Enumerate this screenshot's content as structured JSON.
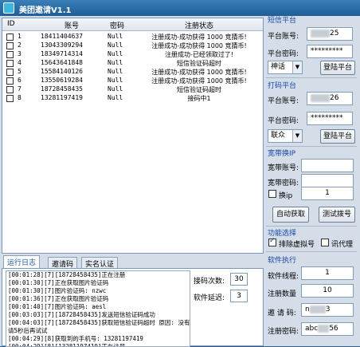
{
  "window": {
    "title": "美团邀请V1.1"
  },
  "table": {
    "headers": {
      "id": "ID",
      "account": "账号",
      "password": "密码",
      "status": "注册状态"
    },
    "rows": [
      {
        "id": "1",
        "account": "18411404637",
        "password": "Null",
        "status": "注册成功-成功获得 1000 竞猜币!"
      },
      {
        "id": "2",
        "account": "13043309294",
        "password": "Null",
        "status": "注册成功-成功获得 1000 竞猜币!"
      },
      {
        "id": "3",
        "account": "18349714314",
        "password": "Null",
        "status": "注册成功-已经领取过了!"
      },
      {
        "id": "4",
        "account": "15643641848",
        "password": "Null",
        "status": "短信验证码超时"
      },
      {
        "id": "5",
        "account": "15584140126",
        "password": "Null",
        "status": "注册成功-成功获得 1000 竞猜币!"
      },
      {
        "id": "6",
        "account": "13550619284",
        "password": "Null",
        "status": "注册成功-成功获得 1000 竞猜币!"
      },
      {
        "id": "7",
        "account": "18728458435",
        "password": "Null",
        "status": "短信验证码超时"
      },
      {
        "id": "8",
        "account": "13281197419",
        "password": "Null",
        "status": "接码中1"
      }
    ]
  },
  "tabs": [
    "运行日志",
    "邀请码",
    "实名认证"
  ],
  "log": {
    "lines": [
      "[00:01:28][7][18728458435]正在注册",
      "[00:01:30][7]正在获取图片验证码",
      "[00:01:30][7]图片验证码: nzwc",
      "[00:01:36][7]正在获取图片验证码",
      "[00:01:40][7]图片验证码: aesl",
      "[00:03:03][7][18728458435]发送短信验证码成功",
      "[00:04:03][7][18728458435]获取短信验证码超时    原因: 没有状态或",
      "  请5秒后再试试",
      "[00:04:29][8]获取到的手机号: 13281197419",
      "[00:04:29][8][13281197419]正在注册",
      "[00:04:30][8]正在获取图片验证码"
    ],
    "retry_label": "接码次数:",
    "retry_value": "30",
    "delay_label": "软件延迟:",
    "delay_value": "3"
  },
  "sms_platform": {
    "title": "短信平台",
    "account_label": "平台账号:",
    "account_suffix": "25",
    "password_label": "平台密码:",
    "password_value": "*********",
    "platform_select": "神话",
    "login_button": "登陆平台"
  },
  "dial_platform": {
    "title": "打码平台",
    "account_label": "平台账号:",
    "account_suffix": "26",
    "password_label": "平台密码:",
    "password_value": "*********",
    "platform_select": "联众",
    "login_button": "登陆平台"
  },
  "broadband": {
    "title": "宽带换IP",
    "account_label": "宽带账号:",
    "password_label": "宽带密码:",
    "switch_ip_label": "换ip",
    "switch_ip_value": "1",
    "auto_get_button": "自动获取",
    "test_dial_button": "测试拨号"
  },
  "features": {
    "title": "功能选择",
    "exclude_virtual_label": "排除虚拟号",
    "proxy_label": "讯代理"
  },
  "software": {
    "title": "软件执行",
    "threads_label": "软件线程:",
    "threads_value": "1",
    "register_count_label": "注册数量",
    "register_count_value": "10",
    "invite_label": "邀 请 码:",
    "invite_value_start": "n",
    "invite_value_end": "3",
    "password_label": "注册密码:",
    "password_value_start": "abc",
    "password_value_end": "56"
  },
  "colors": {
    "title_bar": "#1f5e95",
    "group_title": "#1848a8",
    "window_bg": "#d4dde8"
  }
}
